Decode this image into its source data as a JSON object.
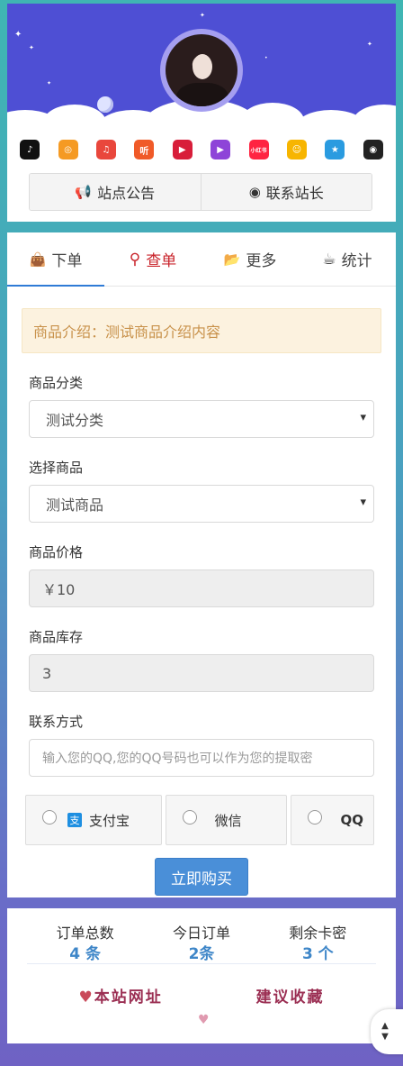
{
  "header": {
    "apps": [
      {
        "icon": "douyin-icon",
        "glyph": "♪",
        "color": "#111111"
      },
      {
        "icon": "app-orange-icon",
        "glyph": "◎",
        "color": "#f59a23"
      },
      {
        "icon": "music-icon",
        "glyph": "♫",
        "color": "#e9473c"
      },
      {
        "icon": "ting-icon",
        "glyph": "听",
        "color": "#f05a28"
      },
      {
        "icon": "video-play-icon",
        "glyph": "▶",
        "color": "#d81e3a"
      },
      {
        "icon": "media-gradient-icon",
        "glyph": "▶",
        "color": "#8e44d8"
      },
      {
        "icon": "xiaohongshu-icon",
        "glyph": "小红书",
        "color": "#ff2442"
      },
      {
        "icon": "weishi-icon",
        "glyph": "☺",
        "color": "#f7b500"
      },
      {
        "icon": "star-icon",
        "glyph": "★",
        "color": "#2a9be0"
      },
      {
        "icon": "qq-penguin-icon",
        "glyph": "◉",
        "color": "#222222"
      }
    ],
    "notice_button": "站点公告",
    "contact_button": "联系站长"
  },
  "tabs": [
    {
      "label": "下单",
      "icon": "shopping-bag-icon"
    },
    {
      "label": "查单",
      "icon": "search-icon"
    },
    {
      "label": "更多",
      "icon": "folder-open-icon"
    },
    {
      "label": "统计",
      "icon": "coffee-cup-icon"
    }
  ],
  "form": {
    "notice": "商品介绍：测试商品介绍内容",
    "category_label": "商品分类",
    "category_value": "测试分类",
    "product_label": "选择商品",
    "product_value": "测试商品",
    "price_label": "商品价格",
    "price_value": "￥10",
    "stock_label": "商品库存",
    "stock_value": "3",
    "contact_label": "联系方式",
    "contact_placeholder": "输入您的QQ,您的QQ号码也可以作为您的提取密",
    "pay_alipay": "支付宝",
    "pay_wechat": "微信",
    "pay_qq": "QQ",
    "buy_button": "立即购买"
  },
  "stats": {
    "total_orders_label": "订单总数",
    "total_orders_value": "4 条",
    "today_orders_label": "今日订单",
    "today_orders_value": "2条",
    "remaining_label": "剩余卡密",
    "remaining_value": "3 个"
  },
  "footer": {
    "favorite_left": "本站网址",
    "favorite_right": "建议收藏"
  },
  "colors": {
    "accent_blue": "#4a8fd8",
    "active_tab_red": "#c9252c",
    "sky": "#4e4fd4",
    "notice_bg": "#fcf2df"
  }
}
